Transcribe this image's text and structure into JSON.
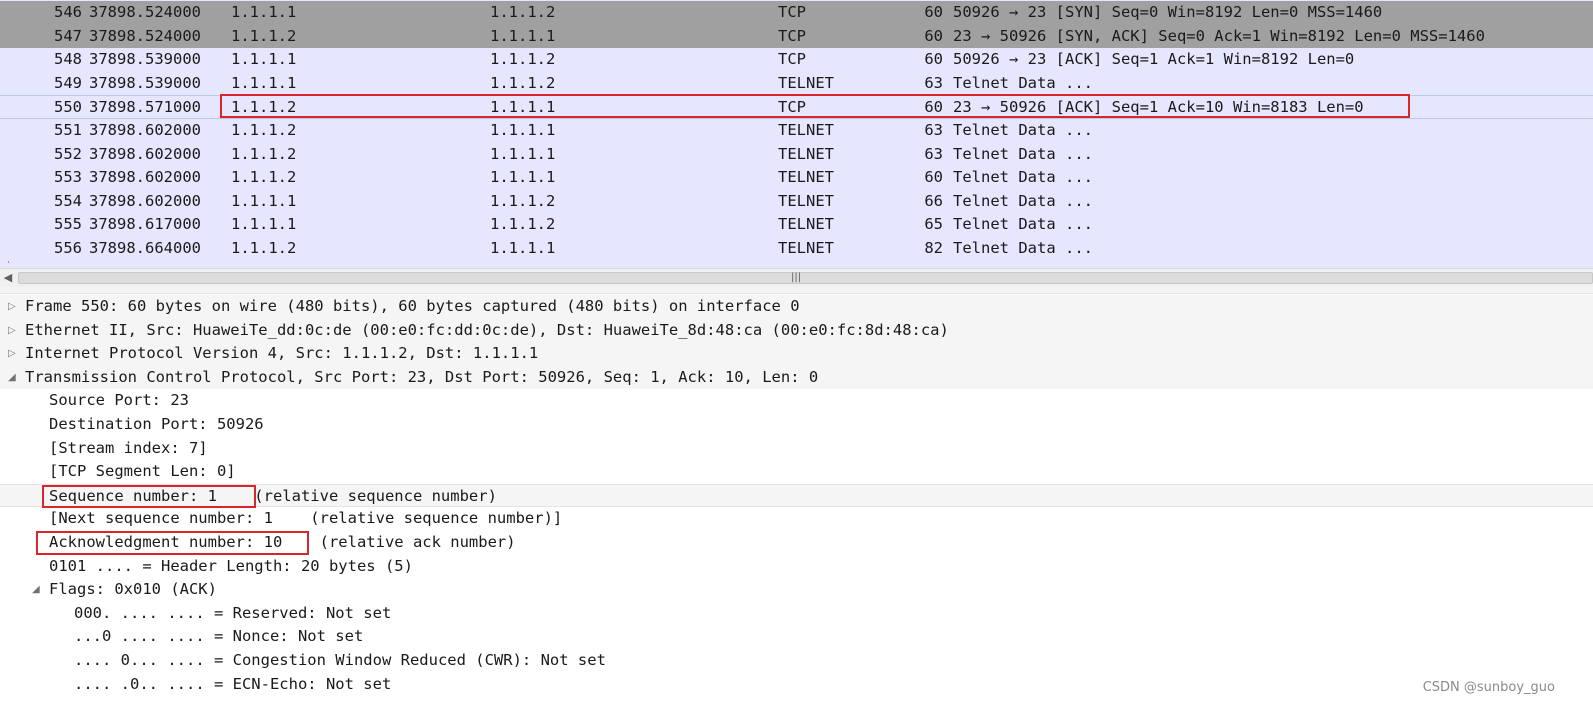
{
  "packets": [
    {
      "no": "546",
      "time": "37898.524000",
      "src": "1.1.1.1",
      "dst": "1.1.1.2",
      "proto": "TCP",
      "len": "60",
      "info": "50926 → 23 [SYN] Seq=0 Win=8192 Len=0 MSS=1460",
      "style": "dark"
    },
    {
      "no": "547",
      "time": "37898.524000",
      "src": "1.1.1.2",
      "dst": "1.1.1.1",
      "proto": "TCP",
      "len": "60",
      "info": "23 → 50926 [SYN, ACK] Seq=0 Ack=1 Win=8192 Len=0 MSS=1460",
      "style": "dark"
    },
    {
      "no": "548",
      "time": "37898.539000",
      "src": "1.1.1.1",
      "dst": "1.1.1.2",
      "proto": "TCP",
      "len": "60",
      "info": "50926 → 23 [ACK] Seq=1 Ack=1 Win=8192 Len=0",
      "style": "light"
    },
    {
      "no": "549",
      "time": "37898.539000",
      "src": "1.1.1.1",
      "dst": "1.1.1.2",
      "proto": "TELNET",
      "len": "63",
      "info": "Telnet Data ...",
      "style": "light"
    },
    {
      "no": "550",
      "time": "37898.571000",
      "src": "1.1.1.2",
      "dst": "1.1.1.1",
      "proto": "TCP",
      "len": "60",
      "info": "23 → 50926 [ACK] Seq=1 Ack=10 Win=8183 Len=0",
      "style": "selected"
    },
    {
      "no": "551",
      "time": "37898.602000",
      "src": "1.1.1.2",
      "dst": "1.1.1.1",
      "proto": "TELNET",
      "len": "63",
      "info": "Telnet Data ...",
      "style": "light"
    },
    {
      "no": "552",
      "time": "37898.602000",
      "src": "1.1.1.2",
      "dst": "1.1.1.1",
      "proto": "TELNET",
      "len": "63",
      "info": "Telnet Data ...",
      "style": "light"
    },
    {
      "no": "553",
      "time": "37898.602000",
      "src": "1.1.1.2",
      "dst": "1.1.1.1",
      "proto": "TELNET",
      "len": "60",
      "info": "Telnet Data ...",
      "style": "light"
    },
    {
      "no": "554",
      "time": "37898.602000",
      "src": "1.1.1.1",
      "dst": "1.1.1.2",
      "proto": "TELNET",
      "len": "66",
      "info": "Telnet Data ...",
      "style": "light"
    },
    {
      "no": "555",
      "time": "37898.617000",
      "src": "1.1.1.1",
      "dst": "1.1.1.2",
      "proto": "TELNET",
      "len": "65",
      "info": "Telnet Data ...",
      "style": "light"
    },
    {
      "no": "556",
      "time": "37898.664000",
      "src": "1.1.1.2",
      "dst": "1.1.1.1",
      "proto": "TELNET",
      "len": "82",
      "info": "Telnet Data ...",
      "style": "light"
    }
  ],
  "scrollbar": {
    "left_arrow": "◀",
    "grip": "|||"
  },
  "details": [
    {
      "text": "Frame 550: 60 bytes on wire (480 bits), 60 bytes captured (480 bits) on interface 0",
      "level": 0,
      "arrow": "▷",
      "style": "top-level"
    },
    {
      "text": "Ethernet II, Src: HuaweiTe_dd:0c:de (00:e0:fc:dd:0c:de), Dst: HuaweiTe_8d:48:ca (00:e0:fc:8d:48:ca)",
      "level": 0,
      "arrow": "▷",
      "style": "top-level"
    },
    {
      "text": "Internet Protocol Version 4, Src: 1.1.1.2, Dst: 1.1.1.1",
      "level": 0,
      "arrow": "▷",
      "style": "top-level"
    },
    {
      "text": "Transmission Control Protocol, Src Port: 23, Dst Port: 50926, Seq: 1, Ack: 10, Len: 0",
      "level": 0,
      "arrow": "◢",
      "style": "top-level"
    },
    {
      "text": "Source Port: 23",
      "level": 1,
      "arrow": "",
      "style": ""
    },
    {
      "text": "Destination Port: 50926",
      "level": 1,
      "arrow": "",
      "style": ""
    },
    {
      "text": "[Stream index: 7]",
      "level": 1,
      "arrow": "",
      "style": ""
    },
    {
      "text": "[TCP Segment Len: 0]",
      "level": 1,
      "arrow": "",
      "style": ""
    },
    {
      "text": "Sequence number: 1    (relative sequence number)",
      "level": 1,
      "arrow": "",
      "style": "hl"
    },
    {
      "text": "[Next sequence number: 1    (relative sequence number)]",
      "level": 1,
      "arrow": "",
      "style": ""
    },
    {
      "text": "Acknowledgment number: 10    (relative ack number)",
      "level": 1,
      "arrow": "",
      "style": ""
    },
    {
      "text": "0101 .... = Header Length: 20 bytes (5)",
      "level": 1,
      "arrow": "",
      "style": ""
    },
    {
      "text": "Flags: 0x010 (ACK)",
      "level": 1,
      "arrow": "◢",
      "style": ""
    },
    {
      "text": "000. .... .... = Reserved: Not set",
      "level": 2,
      "arrow": "",
      "style": ""
    },
    {
      "text": "...0 .... .... = Nonce: Not set",
      "level": 2,
      "arrow": "",
      "style": ""
    },
    {
      "text": ".... 0... .... = Congestion Window Reduced (CWR): Not set",
      "level": 2,
      "arrow": "",
      "style": ""
    },
    {
      "text": ".... .0.. .... = ECN-Echo: Not set",
      "level": 2,
      "arrow": "",
      "style": ""
    }
  ],
  "watermark": "CSDN @sunboy_guo",
  "colors": {
    "highlight_box": "#d9262b",
    "row_light": "#e7e6ff",
    "row_dark": "#a0a0a0"
  },
  "icons": {
    "tree_collapsed": "triangle-right-icon",
    "tree_expanded": "triangle-down-icon"
  }
}
